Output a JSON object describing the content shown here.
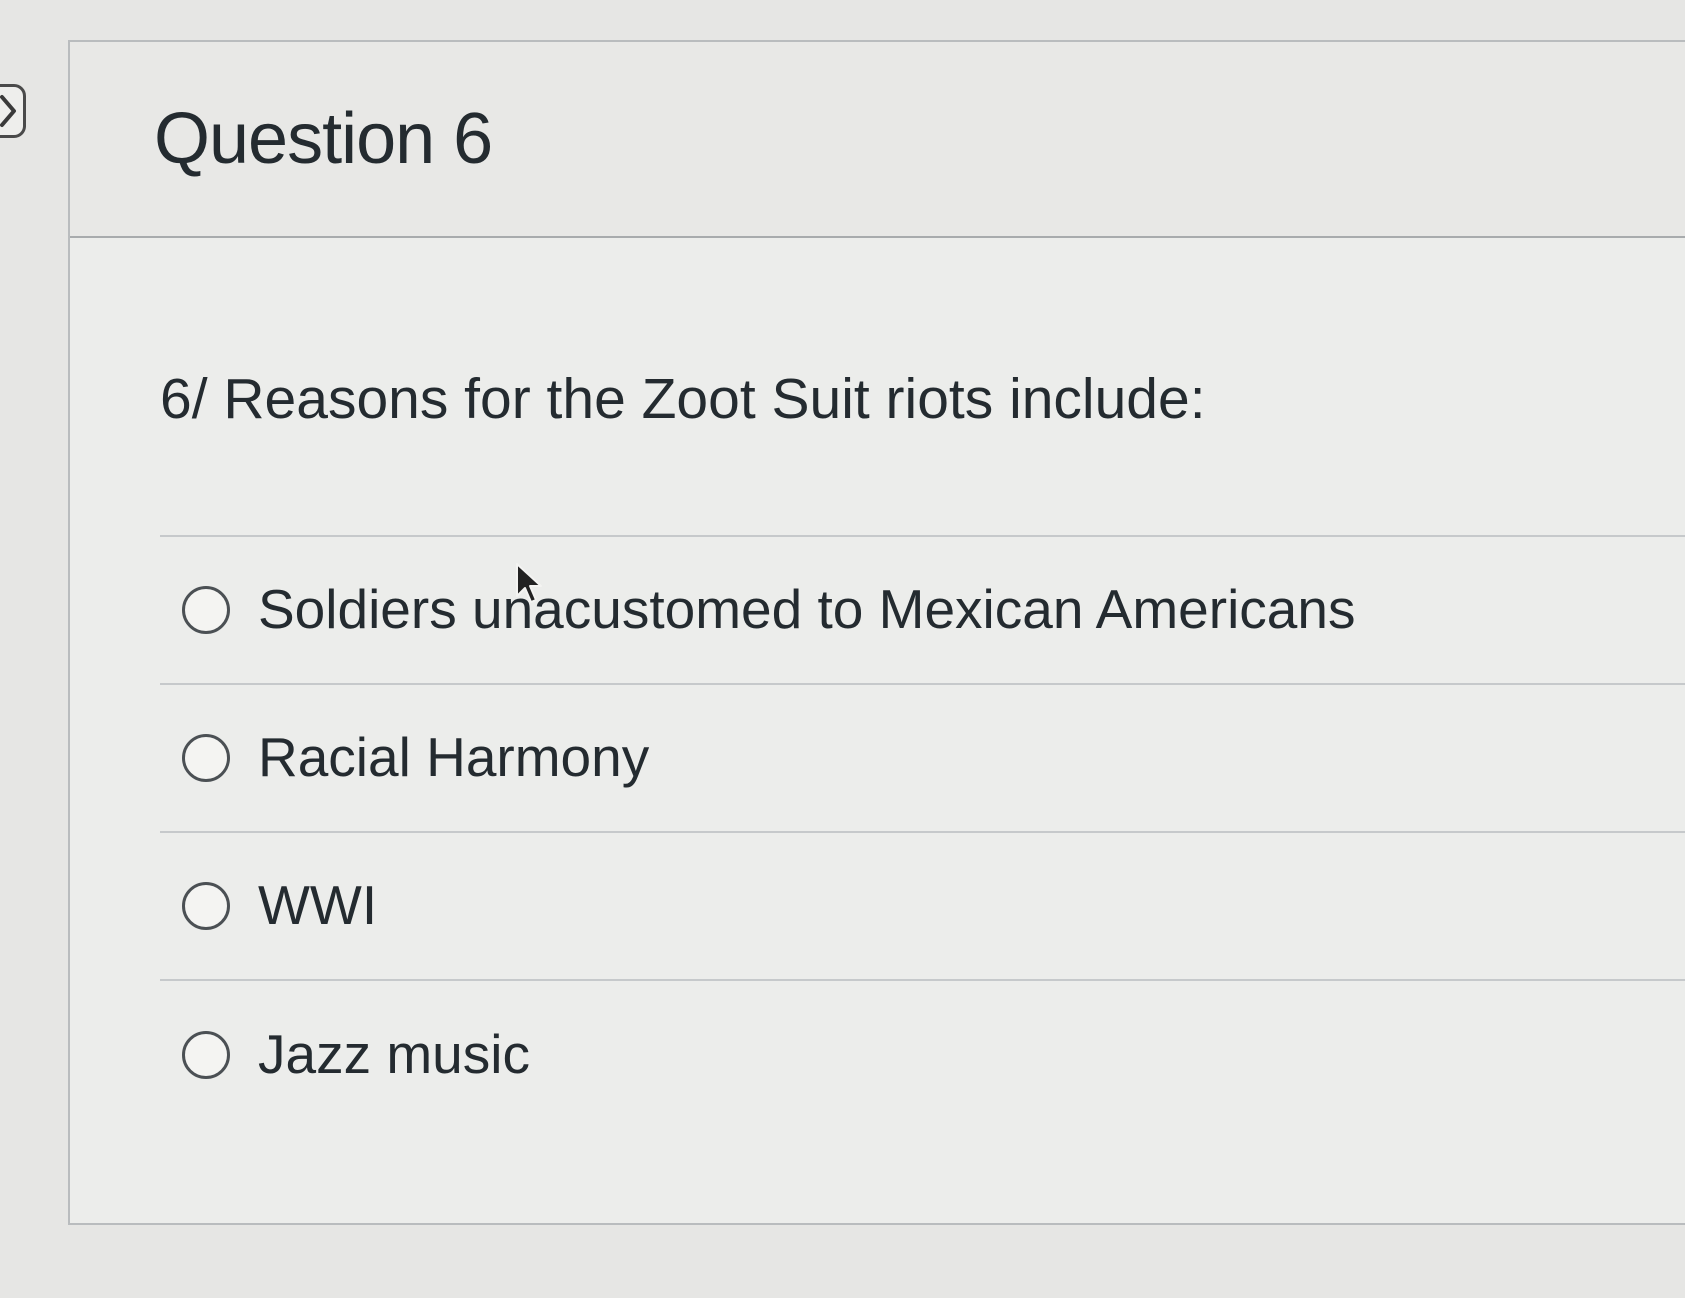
{
  "sidebar": {
    "toggle_icon": "chevron-right-icon"
  },
  "question": {
    "title": "Question 6",
    "text": "6/ Reasons for the Zoot Suit riots include:",
    "answers": [
      {
        "label": "Soldiers unacustomed to Mexican Americans",
        "selected": false
      },
      {
        "label": "Racial Harmony",
        "selected": false
      },
      {
        "label": "WWI",
        "selected": false
      },
      {
        "label": "Jazz music",
        "selected": false
      }
    ]
  },
  "colors": {
    "text": "#242b30",
    "radio_border": "#4b5054",
    "divider": "#c6c9cb"
  }
}
